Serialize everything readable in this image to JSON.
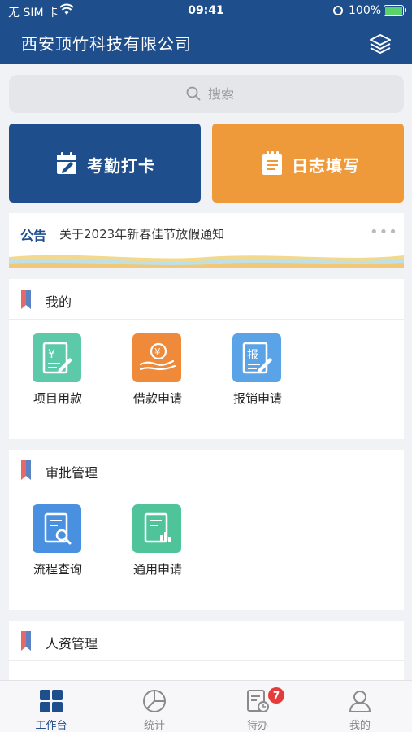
{
  "status_bar": {
    "carrier": "无 SIM 卡",
    "time": "09:41",
    "battery": "100%"
  },
  "header": {
    "title": "西安顶竹科技有限公司",
    "layers_icon": "layers-icon"
  },
  "search": {
    "placeholder": "搜索",
    "icon": "search-icon"
  },
  "quick_actions": {
    "attendance": {
      "label": "考勤打卡",
      "icon": "calendar-edit-icon",
      "color": "#1f4e8c"
    },
    "daily_log": {
      "label": "日志填写",
      "icon": "notebook-icon",
      "color": "#ef9a3a"
    }
  },
  "notice": {
    "tag": "公告",
    "text": "关于2023年新春佳节放假通知",
    "more": "•••"
  },
  "sections": {
    "mine": {
      "title": "我的",
      "items": [
        {
          "label": "项目用款",
          "icon": "project-payment-icon",
          "color": "#5ccaa8"
        },
        {
          "label": "借款申请",
          "icon": "loan-hand-icon",
          "color": "#ef8a3a"
        },
        {
          "label": "报销申请",
          "icon": "reimburse-icon",
          "color": "#5aa3e6"
        }
      ]
    },
    "approval": {
      "title": "审批管理",
      "items": [
        {
          "label": "流程查询",
          "icon": "doc-search-icon",
          "color": "#4a90e0"
        },
        {
          "label": "通用申请",
          "icon": "doc-chart-icon",
          "color": "#4fc49a"
        }
      ]
    },
    "hr": {
      "title": "人资管理"
    }
  },
  "tabbar": {
    "tabs": [
      {
        "label": "工作台",
        "icon": "grid-icon",
        "active": true
      },
      {
        "label": "统计",
        "icon": "pie-chart-icon",
        "active": false
      },
      {
        "label": "待办",
        "icon": "todo-clock-icon",
        "active": false,
        "badge": "7"
      },
      {
        "label": "我的",
        "icon": "user-icon",
        "active": false
      }
    ]
  },
  "colors": {
    "brand": "#1f4e8c",
    "accent": "#ef9a3a",
    "badge": "#e53b3b"
  }
}
